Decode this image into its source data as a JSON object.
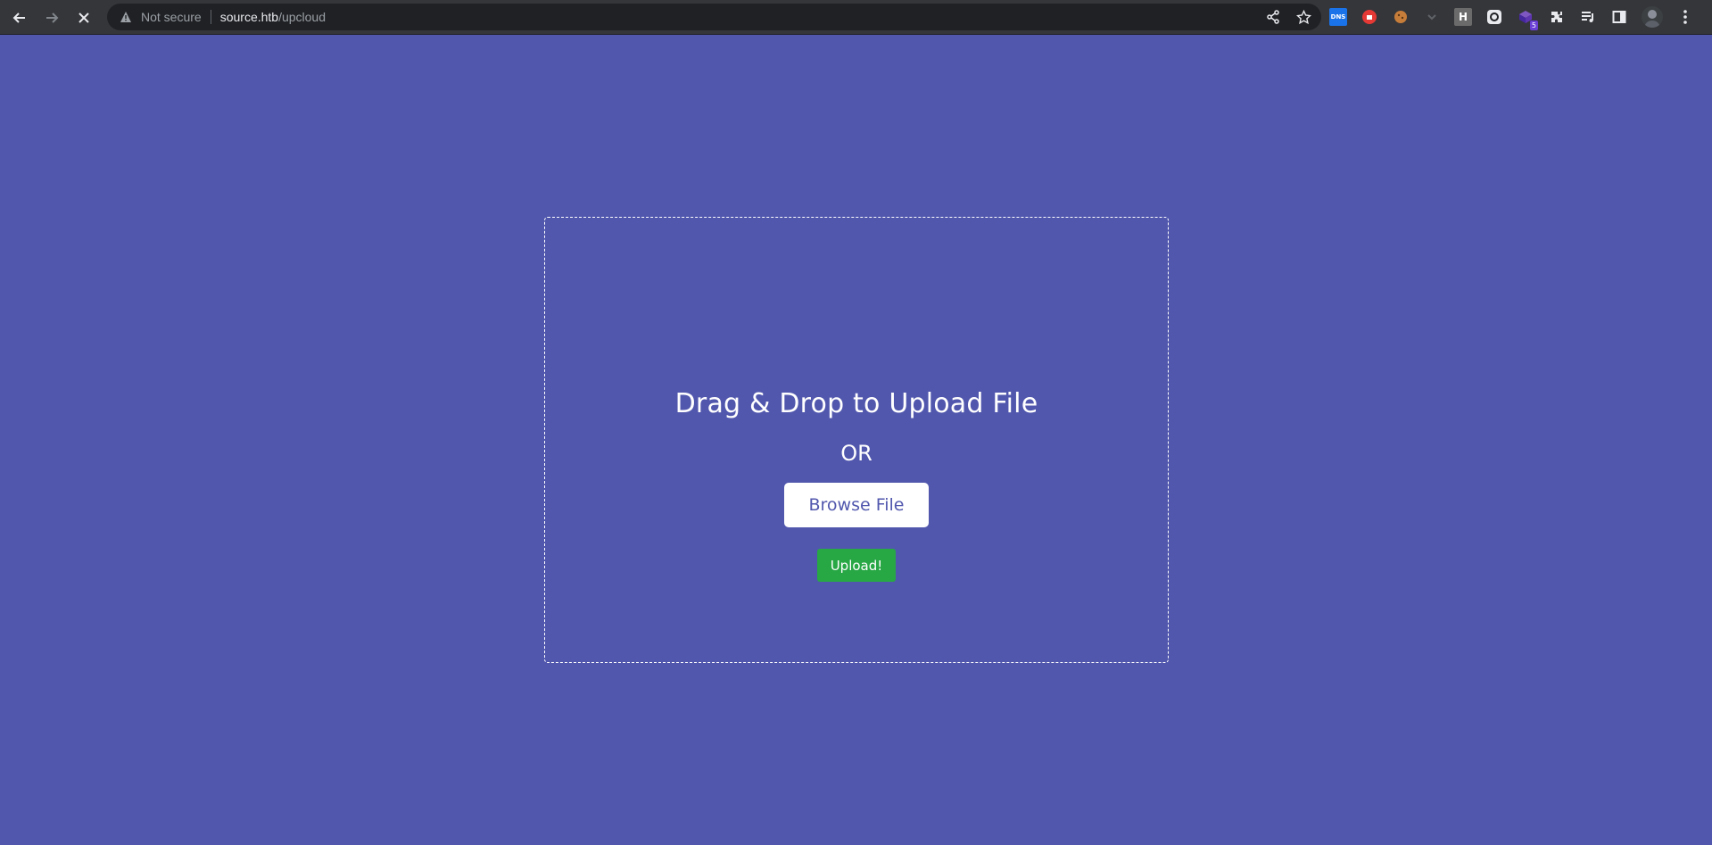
{
  "browser": {
    "back_icon": "arrow-left-icon",
    "forward_icon": "arrow-right-icon",
    "stop_icon": "close-icon",
    "security_label": "Not secure",
    "url_host": "source.htb",
    "url_path": "/upcloud",
    "extensions": [
      {
        "name": "dns-extension-icon",
        "label": "DNS",
        "color": "#1a73e8"
      },
      {
        "name": "adblock-extension-icon",
        "label": "",
        "color": "#e53935"
      },
      {
        "name": "cookie-extension-icon",
        "label": "",
        "color": "#c77d3a"
      },
      {
        "name": "arrow-extension-icon",
        "label": "",
        "color": "#5f6368"
      },
      {
        "name": "h-extension-icon",
        "label": "H",
        "color": "#6b6b6b"
      },
      {
        "name": "link-extension-icon",
        "label": "",
        "color": "#e8eaed"
      },
      {
        "name": "purple-extension-icon",
        "label": "",
        "badge": "5",
        "color": "#5e35b1"
      }
    ]
  },
  "upload": {
    "heading": "Drag & Drop to Upload File",
    "or_text": "OR",
    "browse_label": "Browse File",
    "upload_label": "Upload!"
  },
  "colors": {
    "page_background": "#5157ad",
    "upload_button": "#28a745",
    "browse_text": "#5157ad"
  }
}
